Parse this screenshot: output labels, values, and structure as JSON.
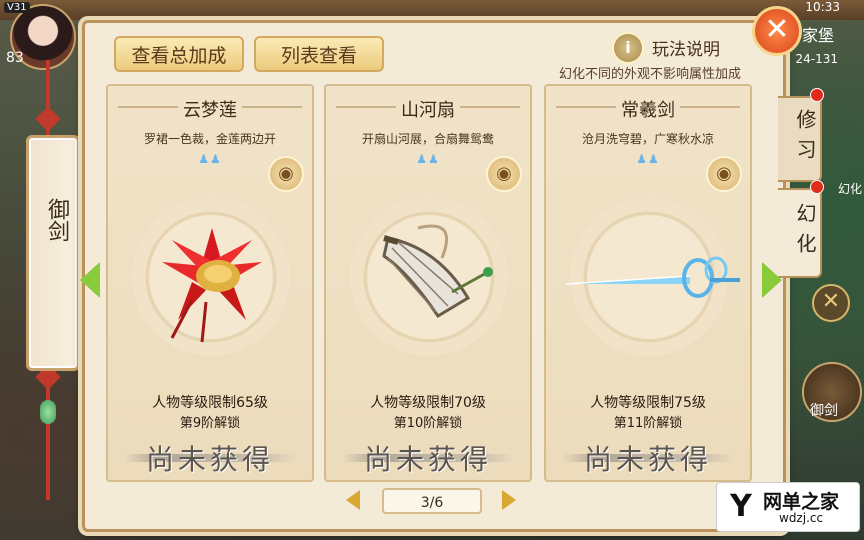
{
  "hud": {
    "level_badge": "V31",
    "player_num": "83",
    "clock": "10:33",
    "home_label": "家堡",
    "coords": "24-131",
    "bg_label": "幻化",
    "right_button_label": "御剑"
  },
  "left_tab": {
    "label": "御剑"
  },
  "toolbar": {
    "total_bonus": "查看总加成",
    "list_view": "列表查看"
  },
  "help": {
    "icon_glyph": "i",
    "label": "玩法说明",
    "note": "幻化不同的外观不影响属性加成"
  },
  "side_tabs": [
    {
      "label": "修习"
    },
    {
      "label": "幻化"
    }
  ],
  "cards": [
    {
      "title": "云梦莲",
      "desc": "罗裙一色裁，金莲两边开",
      "requirement": "人物等级限制65级",
      "unlock": "第9阶解锁",
      "status": "尚未获得",
      "icon": "lotus-icon"
    },
    {
      "title": "山河扇",
      "desc": "开扇山河展，合扇舞鸳鸯",
      "requirement": "人物等级限制70级",
      "unlock": "第10阶解锁",
      "status": "尚未获得",
      "icon": "fan-icon"
    },
    {
      "title": "常羲剑",
      "desc": "沧月洗穹碧，广寒秋水凉",
      "requirement": "人物等级限制75级",
      "unlock": "第11阶解锁",
      "status": "尚未获得",
      "icon": "sword-icon"
    }
  ],
  "pager": {
    "text": "3/6"
  },
  "watermark": {
    "name": "网单之家",
    "url": "wdzj.cc"
  },
  "colors": {
    "accent": "#8acb3a",
    "close": "#d8441a",
    "panel": "#f3ead8"
  }
}
